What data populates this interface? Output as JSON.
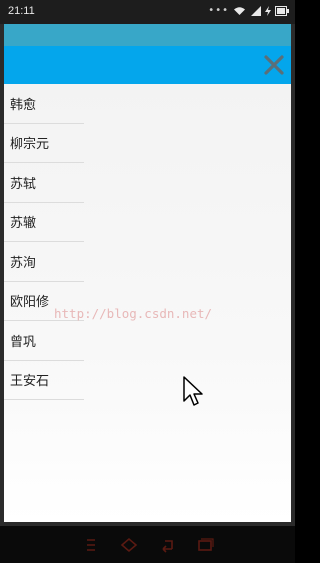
{
  "status_bar": {
    "time": "21:11",
    "icons": [
      "more-dots-icon",
      "wifi-icon",
      "signal-icon",
      "charging-icon",
      "battery-icon"
    ]
  },
  "header": {
    "close_icon": "close-icon"
  },
  "list": {
    "items": [
      {
        "label": "韩愈"
      },
      {
        "label": "柳宗元"
      },
      {
        "label": "苏轼"
      },
      {
        "label": "苏辙"
      },
      {
        "label": "苏洵"
      },
      {
        "label": "欧阳修"
      },
      {
        "label": "曾巩"
      },
      {
        "label": "王安石"
      }
    ]
  },
  "watermark": "http://blog.csdn.net/",
  "nav_bar": {
    "icons": [
      "menu-icon",
      "home-icon",
      "back-icon",
      "recent-apps-icon"
    ]
  },
  "colors": {
    "status_bar": "#1d1d1d",
    "top_strip": "#38a7c8",
    "header": "#04a6ec",
    "nav_icons": "#5a1a12"
  }
}
